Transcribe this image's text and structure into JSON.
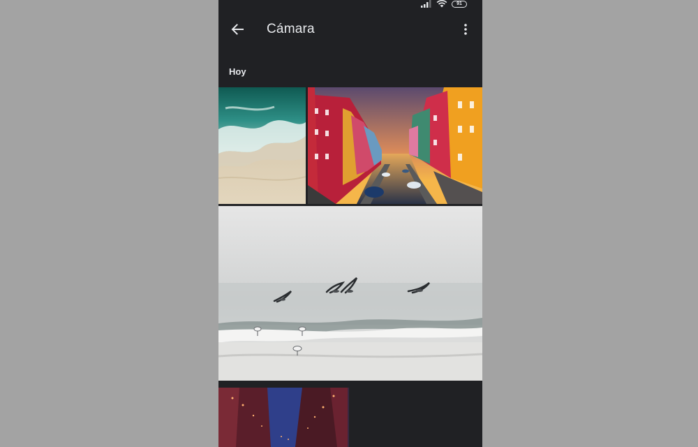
{
  "status_bar": {
    "battery_level": "91",
    "icons": [
      "signal-icon",
      "wifi-icon",
      "battery-icon"
    ]
  },
  "app_bar": {
    "title": "Cámara",
    "back_icon": "arrow-back-icon",
    "menu_icon": "more-vertical-icon"
  },
  "gallery": {
    "section_title": "Hoy",
    "photos": [
      {
        "subject": "beach-waves"
      },
      {
        "subject": "colorful-canal-sunset"
      },
      {
        "subject": "seagulls-over-sea"
      },
      {
        "subject": "night-street-lights"
      }
    ]
  },
  "colors": {
    "app_background": "#202124",
    "page_background": "#a3a3a3",
    "text_primary": "#e8eaed"
  }
}
